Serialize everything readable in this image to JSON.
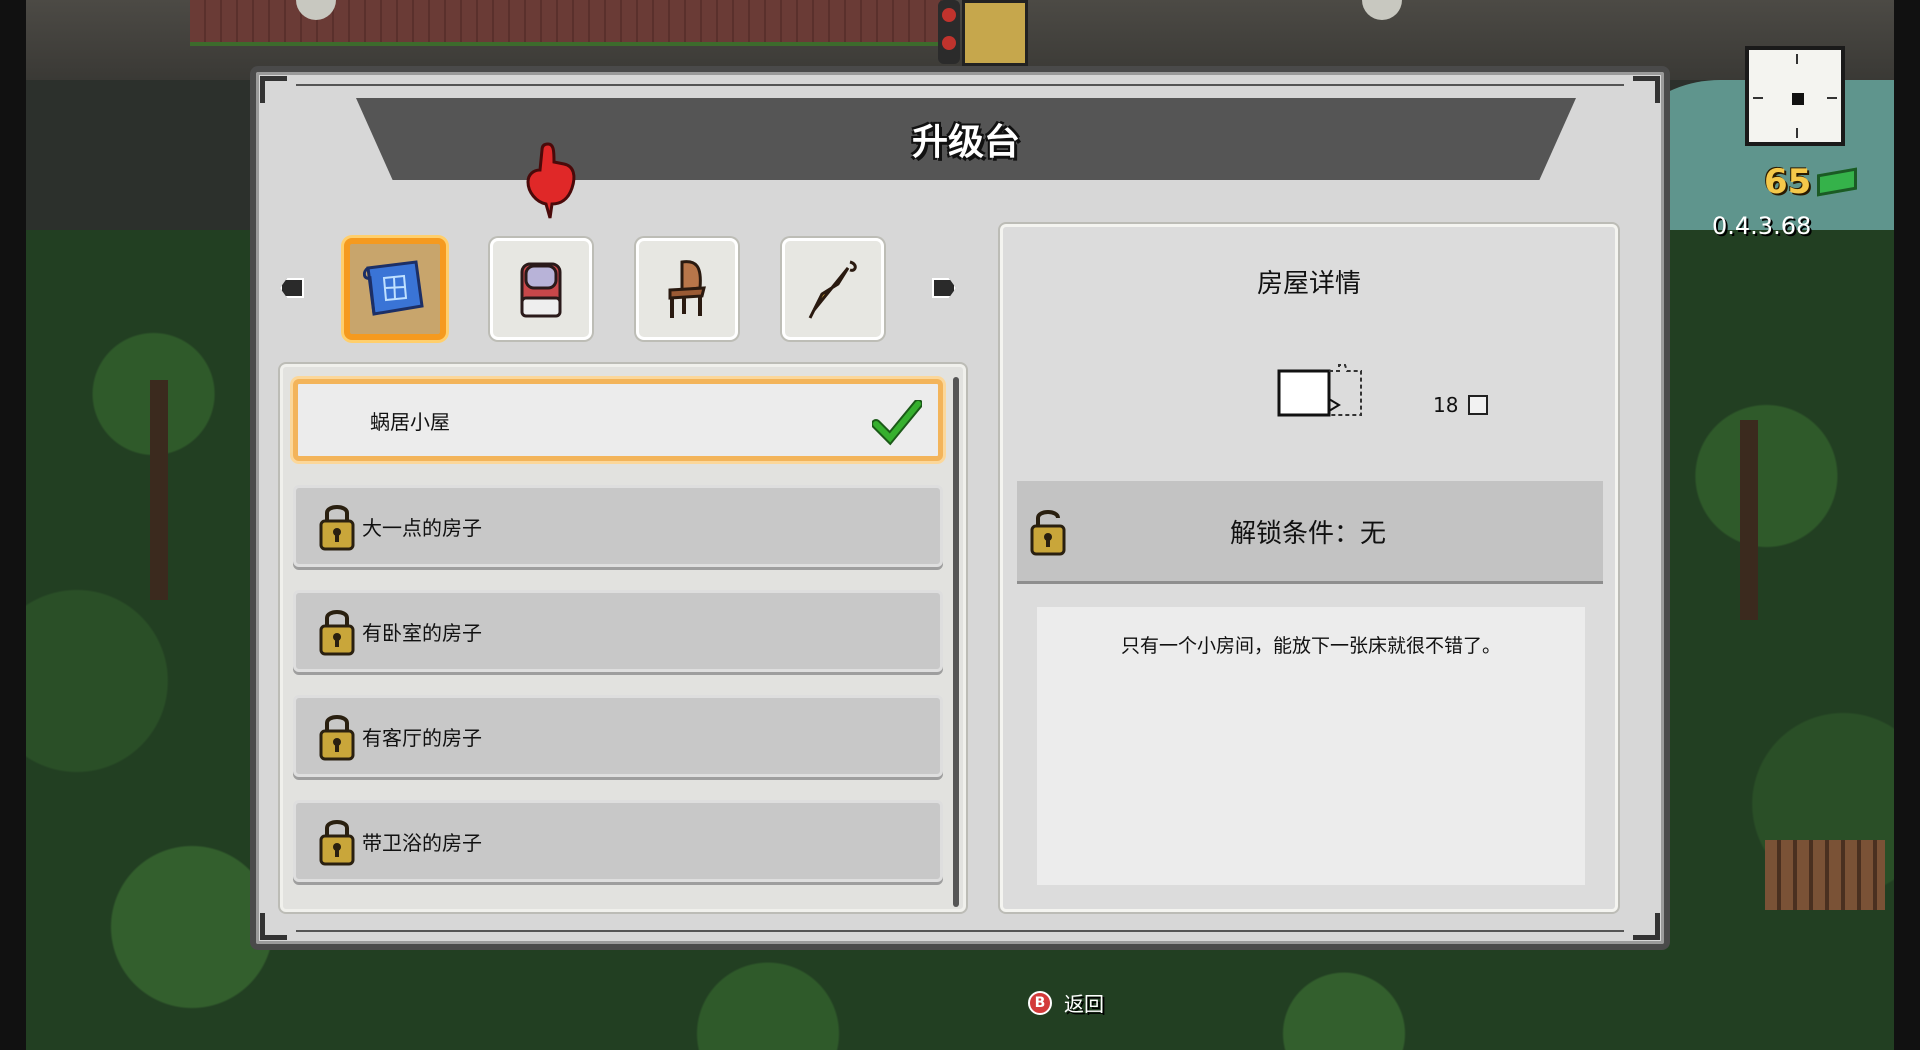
{
  "hud": {
    "money": "65",
    "version": "0.4.3.68"
  },
  "panel": {
    "title": "升级台"
  },
  "categories": [
    {
      "name": "blueprint-icon",
      "active": true
    },
    {
      "name": "bed-icon",
      "active": false
    },
    {
      "name": "chair-icon",
      "active": false
    },
    {
      "name": "umbrella-icon",
      "active": false
    }
  ],
  "house_list": [
    {
      "label": "蜗居小屋",
      "selected": true,
      "locked": false,
      "owned": true
    },
    {
      "label": "大一点的房子",
      "selected": false,
      "locked": true
    },
    {
      "label": "有卧室的房子",
      "selected": false,
      "locked": true
    },
    {
      "label": "有客厅的房子",
      "selected": false,
      "locked": true
    },
    {
      "label": "带卫浴的房子",
      "selected": false,
      "locked": true
    }
  ],
  "details": {
    "title": "房屋详情",
    "size": "18",
    "unlock_condition": "解锁条件：无",
    "description": "只有一个小房间，能放下一张床就很不错了。"
  },
  "footer": {
    "back_button_glyph": "B",
    "back_label": "返回"
  },
  "colors": {
    "selection_accent": "#f59a1f",
    "money": "#f5c84a",
    "check": "#2f9a2a",
    "back_button": "#d33a3a"
  }
}
